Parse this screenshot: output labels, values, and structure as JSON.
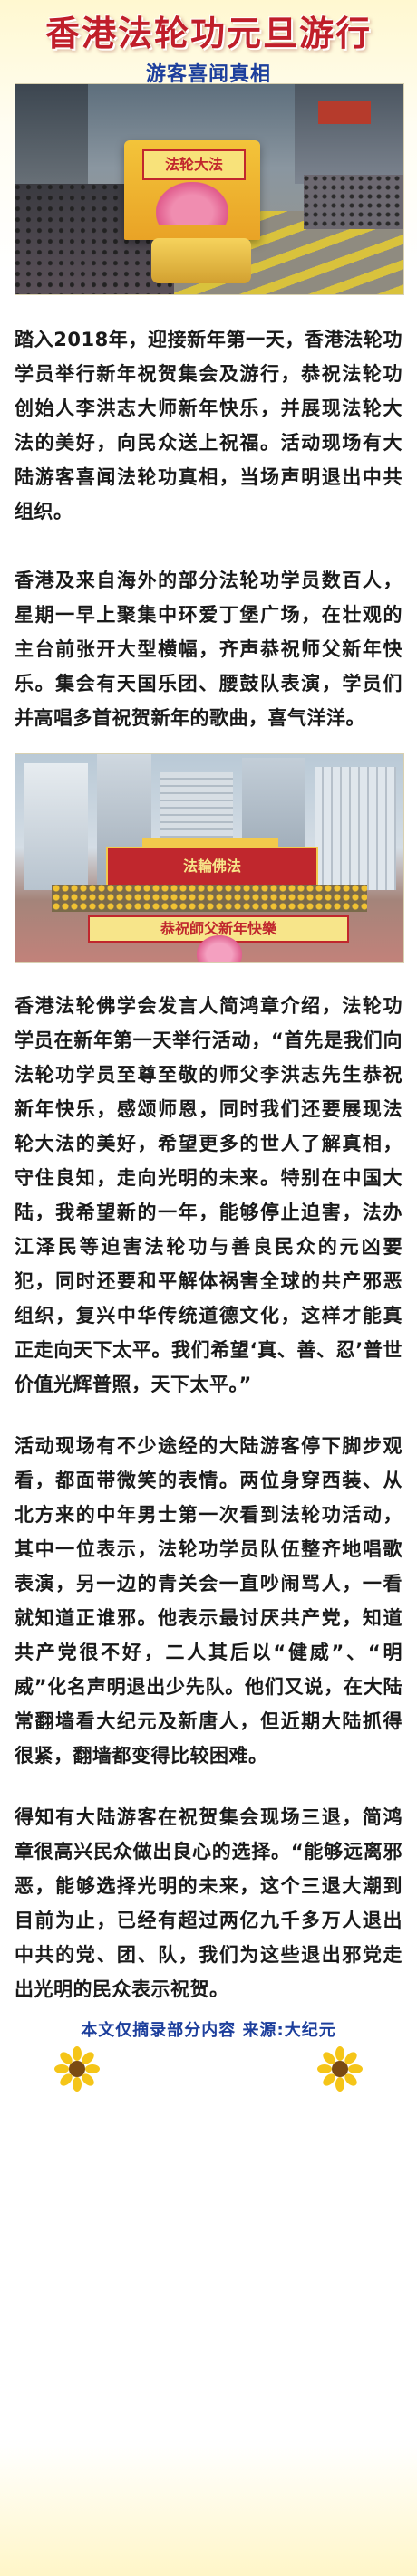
{
  "header": {
    "title": "香港法轮功元旦游行",
    "subtitle": "游客喜闻真相"
  },
  "photos": {
    "photo1": {
      "float_sign": "法轮大法"
    },
    "photo2": {
      "stage_sign": "法輪佛法",
      "banner": "恭祝師父新年快樂"
    }
  },
  "paragraphs": [
    "踏入2018年，迎接新年第一天，香港法轮功学员举行新年祝贺集会及游行，恭祝法轮功创始人李洪志大师新年快乐，并展现法轮大法的美好，向民众送上祝福。活动现场有大陆游客喜闻法轮功真相，当场声明退出中共组织。",
    "香港及来自海外的部分法轮功学员数百人，星期一早上聚集中环爱丁堡广场，在壮观的主台前张开大型横幅，齐声恭祝师父新年快乐。集会有天国乐团、腰鼓队表演，学员们并高唱多首祝贺新年的歌曲，喜气洋洋。",
    "香港法轮佛学会发言人简鸿章介绍，法轮功学员在新年第一天举行活动，“首先是我们向法轮功学员至尊至敬的师父李洪志先生恭祝新年快乐，感颂师恩，同时我们还要展现法轮大法的美好，希望更多的世人了解真相，守住良知，走向光明的未来。特别在中国大陆，我希望新的一年，能够停止迫害，法办江泽民等迫害法轮功与善良民众的元凶要犯，同时还要和平解体祸害全球的共产邪恶组织，复兴中华传统道德文化，这样才能真正走向天下太平。我们希望‘真、善、忍’普世价值光辉普照，天下太平。”",
    "活动现场有不少途经的大陆游客停下脚步观看，都面带微笑的表情。两位身穿西装、从北方来的中年男士第一次看到法轮功活动，其中一位表示，法轮功学员队伍整齐地唱歌表演，另一边的青关会一直吵闹骂人，一看就知道正谁邪。他表示最讨厌共产党，知道共产党很不好，二人其后以“健威”、“明威”化名声明退出少先队。他们又说，在大陆常翻墙看大纪元及新唐人，但近期大陆抓得很紧，翻墙都变得比较困难。",
    "得知有大陆游客在祝贺集会现场三退，简鸿章很高兴民众做出良心的选择。“能够远离邪恶，能够选择光明的未来，这个三退大潮到目前为止，已经有超过两亿九千多万人退出中共的党、团、队，我们为这些退出邪党走出光明的民众表示祝贺。"
  ],
  "footer": {
    "note": "本文仅摘录部分内容  来源:大纪元"
  },
  "colors": {
    "title": "#c01e2a",
    "subtitle": "#1d3f9c",
    "footer": "#1d3f9c"
  },
  "icons": [
    "sunflower-icon"
  ]
}
